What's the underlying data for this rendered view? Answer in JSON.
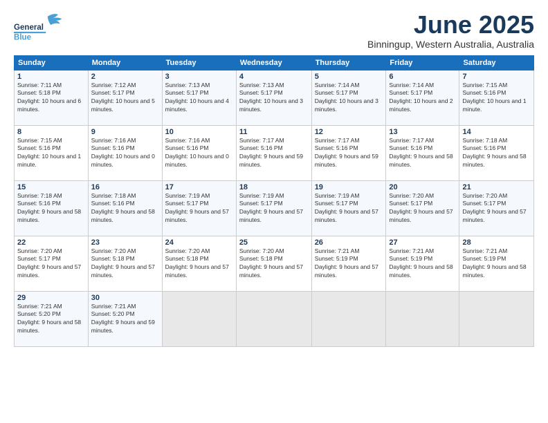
{
  "header": {
    "logo_general": "General",
    "logo_blue": "Blue",
    "month": "June 2025",
    "location": "Binningup, Western Australia, Australia"
  },
  "weekdays": [
    "Sunday",
    "Monday",
    "Tuesday",
    "Wednesday",
    "Thursday",
    "Friday",
    "Saturday"
  ],
  "weeks": [
    [
      {
        "day": "1",
        "sunrise": "Sunrise: 7:11 AM",
        "sunset": "Sunset: 5:18 PM",
        "daylight": "Daylight: 10 hours and 6 minutes."
      },
      {
        "day": "2",
        "sunrise": "Sunrise: 7:12 AM",
        "sunset": "Sunset: 5:17 PM",
        "daylight": "Daylight: 10 hours and 5 minutes."
      },
      {
        "day": "3",
        "sunrise": "Sunrise: 7:13 AM",
        "sunset": "Sunset: 5:17 PM",
        "daylight": "Daylight: 10 hours and 4 minutes."
      },
      {
        "day": "4",
        "sunrise": "Sunrise: 7:13 AM",
        "sunset": "Sunset: 5:17 PM",
        "daylight": "Daylight: 10 hours and 3 minutes."
      },
      {
        "day": "5",
        "sunrise": "Sunrise: 7:14 AM",
        "sunset": "Sunset: 5:17 PM",
        "daylight": "Daylight: 10 hours and 3 minutes."
      },
      {
        "day": "6",
        "sunrise": "Sunrise: 7:14 AM",
        "sunset": "Sunset: 5:17 PM",
        "daylight": "Daylight: 10 hours and 2 minutes."
      },
      {
        "day": "7",
        "sunrise": "Sunrise: 7:15 AM",
        "sunset": "Sunset: 5:16 PM",
        "daylight": "Daylight: 10 hours and 1 minute."
      }
    ],
    [
      {
        "day": "8",
        "sunrise": "Sunrise: 7:15 AM",
        "sunset": "Sunset: 5:16 PM",
        "daylight": "Daylight: 10 hours and 1 minute."
      },
      {
        "day": "9",
        "sunrise": "Sunrise: 7:16 AM",
        "sunset": "Sunset: 5:16 PM",
        "daylight": "Daylight: 10 hours and 0 minutes."
      },
      {
        "day": "10",
        "sunrise": "Sunrise: 7:16 AM",
        "sunset": "Sunset: 5:16 PM",
        "daylight": "Daylight: 10 hours and 0 minutes."
      },
      {
        "day": "11",
        "sunrise": "Sunrise: 7:17 AM",
        "sunset": "Sunset: 5:16 PM",
        "daylight": "Daylight: 9 hours and 59 minutes."
      },
      {
        "day": "12",
        "sunrise": "Sunrise: 7:17 AM",
        "sunset": "Sunset: 5:16 PM",
        "daylight": "Daylight: 9 hours and 59 minutes."
      },
      {
        "day": "13",
        "sunrise": "Sunrise: 7:17 AM",
        "sunset": "Sunset: 5:16 PM",
        "daylight": "Daylight: 9 hours and 58 minutes."
      },
      {
        "day": "14",
        "sunrise": "Sunrise: 7:18 AM",
        "sunset": "Sunset: 5:16 PM",
        "daylight": "Daylight: 9 hours and 58 minutes."
      }
    ],
    [
      {
        "day": "15",
        "sunrise": "Sunrise: 7:18 AM",
        "sunset": "Sunset: 5:16 PM",
        "daylight": "Daylight: 9 hours and 58 minutes."
      },
      {
        "day": "16",
        "sunrise": "Sunrise: 7:18 AM",
        "sunset": "Sunset: 5:16 PM",
        "daylight": "Daylight: 9 hours and 58 minutes."
      },
      {
        "day": "17",
        "sunrise": "Sunrise: 7:19 AM",
        "sunset": "Sunset: 5:17 PM",
        "daylight": "Daylight: 9 hours and 57 minutes."
      },
      {
        "day": "18",
        "sunrise": "Sunrise: 7:19 AM",
        "sunset": "Sunset: 5:17 PM",
        "daylight": "Daylight: 9 hours and 57 minutes."
      },
      {
        "day": "19",
        "sunrise": "Sunrise: 7:19 AM",
        "sunset": "Sunset: 5:17 PM",
        "daylight": "Daylight: 9 hours and 57 minutes."
      },
      {
        "day": "20",
        "sunrise": "Sunrise: 7:20 AM",
        "sunset": "Sunset: 5:17 PM",
        "daylight": "Daylight: 9 hours and 57 minutes."
      },
      {
        "day": "21",
        "sunrise": "Sunrise: 7:20 AM",
        "sunset": "Sunset: 5:17 PM",
        "daylight": "Daylight: 9 hours and 57 minutes."
      }
    ],
    [
      {
        "day": "22",
        "sunrise": "Sunrise: 7:20 AM",
        "sunset": "Sunset: 5:17 PM",
        "daylight": "Daylight: 9 hours and 57 minutes."
      },
      {
        "day": "23",
        "sunrise": "Sunrise: 7:20 AM",
        "sunset": "Sunset: 5:18 PM",
        "daylight": "Daylight: 9 hours and 57 minutes."
      },
      {
        "day": "24",
        "sunrise": "Sunrise: 7:20 AM",
        "sunset": "Sunset: 5:18 PM",
        "daylight": "Daylight: 9 hours and 57 minutes."
      },
      {
        "day": "25",
        "sunrise": "Sunrise: 7:20 AM",
        "sunset": "Sunset: 5:18 PM",
        "daylight": "Daylight: 9 hours and 57 minutes."
      },
      {
        "day": "26",
        "sunrise": "Sunrise: 7:21 AM",
        "sunset": "Sunset: 5:19 PM",
        "daylight": "Daylight: 9 hours and 57 minutes."
      },
      {
        "day": "27",
        "sunrise": "Sunrise: 7:21 AM",
        "sunset": "Sunset: 5:19 PM",
        "daylight": "Daylight: 9 hours and 58 minutes."
      },
      {
        "day": "28",
        "sunrise": "Sunrise: 7:21 AM",
        "sunset": "Sunset: 5:19 PM",
        "daylight": "Daylight: 9 hours and 58 minutes."
      }
    ],
    [
      {
        "day": "29",
        "sunrise": "Sunrise: 7:21 AM",
        "sunset": "Sunset: 5:20 PM",
        "daylight": "Daylight: 9 hours and 58 minutes."
      },
      {
        "day": "30",
        "sunrise": "Sunrise: 7:21 AM",
        "sunset": "Sunset: 5:20 PM",
        "daylight": "Daylight: 9 hours and 59 minutes."
      },
      {
        "day": "",
        "sunrise": "",
        "sunset": "",
        "daylight": ""
      },
      {
        "day": "",
        "sunrise": "",
        "sunset": "",
        "daylight": ""
      },
      {
        "day": "",
        "sunrise": "",
        "sunset": "",
        "daylight": ""
      },
      {
        "day": "",
        "sunrise": "",
        "sunset": "",
        "daylight": ""
      },
      {
        "day": "",
        "sunrise": "",
        "sunset": "",
        "daylight": ""
      }
    ]
  ]
}
